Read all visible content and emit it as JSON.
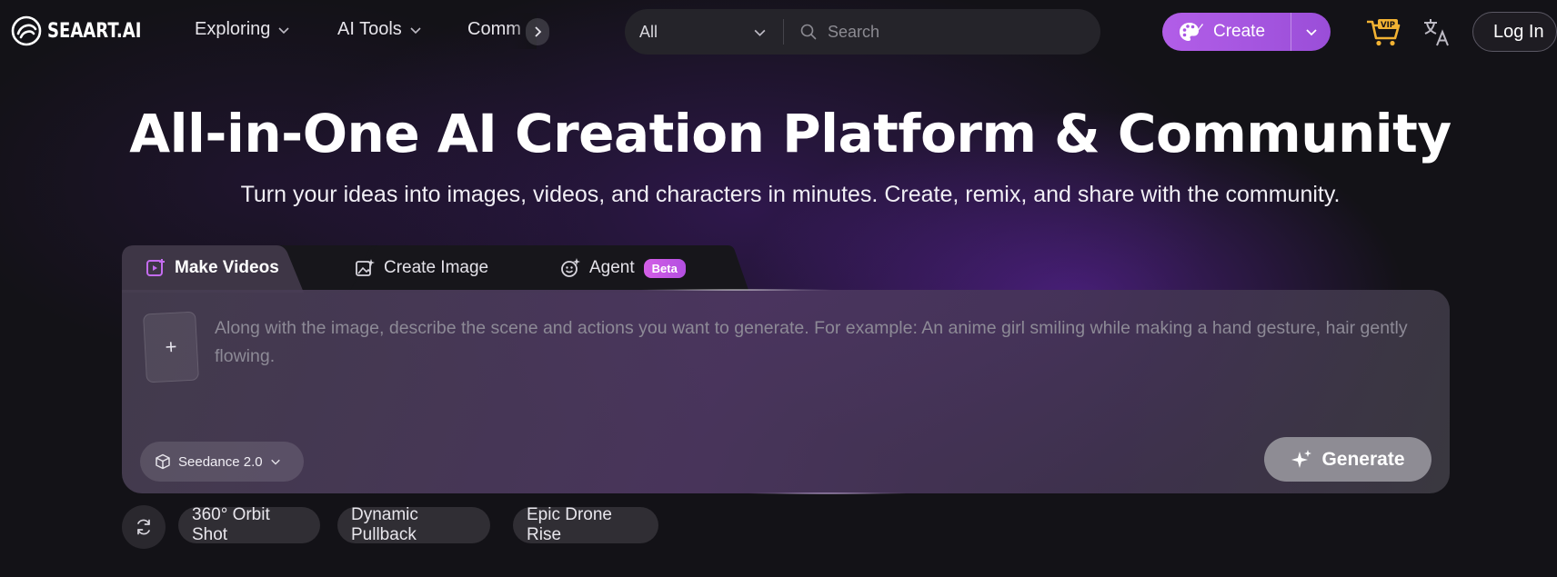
{
  "nav": {
    "logo_text": "SEAART.AI",
    "links": [
      {
        "label": "Exploring",
        "icon": "chevron-down-icon"
      },
      {
        "label": "AI Tools",
        "icon": "chevron-down-icon"
      },
      {
        "label": "Comm",
        "icon": "chevron-right-icon"
      }
    ],
    "search": {
      "category": "All",
      "placeholder": "Search",
      "value": ""
    },
    "create_label": "Create",
    "vip_label": "VIP",
    "login_label": "Log In"
  },
  "hero": {
    "title": "All-in-One AI Creation Platform & Community",
    "subtitle": "Turn your ideas into images, videos, and characters in minutes. Create, remix, and share with the community."
  },
  "tabs": [
    {
      "label": "Make Videos",
      "active": true,
      "icon": "video-plus-icon"
    },
    {
      "label": "Create Image",
      "active": false,
      "icon": "image-sparkle-icon"
    },
    {
      "label": "Agent",
      "active": false,
      "icon": "agent-smile-icon",
      "badge": "Beta"
    }
  ],
  "composer": {
    "upload_symbol": "+",
    "prompt_placeholder": "Along with the image, describe the scene and actions you want to generate. For example: An anime girl smiling while making a hand gesture, hair gently flowing.",
    "prompt_value": "",
    "model_label": "Seedance 2.0",
    "generate_label": "Generate"
  },
  "suggestions": [
    "360° Orbit Shot",
    "Dynamic Pullback",
    "Epic Drone Rise"
  ],
  "colors": {
    "accent": "#a855e3",
    "background": "#131217",
    "generate_disabled": "#8e8c94"
  }
}
